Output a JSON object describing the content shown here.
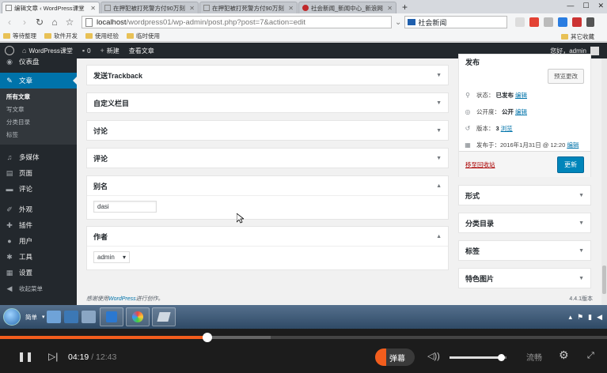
{
  "browser": {
    "tabs": [
      {
        "label": "编辑文章 ‹ WordPress课堂",
        "active": true
      },
      {
        "label": "在押犯被打死警方付90万刻",
        "active": false
      },
      {
        "label": "在押犯被打死警方付90万刻",
        "active": false
      },
      {
        "label": "社会新闻_新闻中心_新浪网",
        "active": false
      }
    ],
    "new_tab": "+",
    "window_controls": [
      "—",
      "☐",
      "✕"
    ],
    "url_host": "localhost",
    "url_path": "/wordpress01/wp-admin/post.php?post=7&action=edit",
    "search_value": "社会新闻",
    "bookmarks": [
      "等待整理",
      "软件开发",
      "使用经验",
      "临时使用"
    ],
    "bookmarks_right": "其它收藏"
  },
  "adminbar": {
    "site_name": "WordPress课堂",
    "comments_count": "0",
    "new_label": "新建",
    "view_post": "查看文章",
    "howdy": "您好，admin"
  },
  "sidebar": {
    "dashboard": "仪表盘",
    "posts": "文章",
    "sub_items": [
      "所有文章",
      "写文章",
      "分类目录",
      "标签"
    ],
    "media": "多媒体",
    "pages": "页面",
    "comments": "评论",
    "appearance": "外观",
    "plugins": "插件",
    "users": "用户",
    "tools": "工具",
    "settings": "设置",
    "collapse": "收起菜单"
  },
  "main": {
    "boxes": {
      "trackback": "发送Trackback",
      "custom_fields": "自定义栏目",
      "discussion": "讨论",
      "comments": "评论",
      "slug": "别名",
      "author": "作者"
    },
    "slug_value": "dasi",
    "author_value": "admin",
    "footer_prefix": "感谢使用",
    "footer_link": "WordPress",
    "footer_suffix": "进行创作。",
    "version": "4.4.1版本"
  },
  "publish": {
    "title": "发布",
    "preview_btn": "预览更改",
    "status_label": "状态：",
    "status_value": "已发布",
    "visibility_label": "公开度：",
    "visibility_value": "公开",
    "revisions_label": "版本：",
    "revisions_value": "3",
    "revisions_link": "浏览",
    "published_label": "发布于：",
    "published_value": "2016年1月31日 @ 12:20",
    "edit": "编辑",
    "trash": "移至回收站",
    "update_btn": "更新"
  },
  "right_boxes": {
    "format": "形式",
    "categories": "分类目录",
    "tags": "标签",
    "featured_image": "特色图片"
  },
  "taskbar": {
    "label": "简单"
  },
  "player": {
    "progress": 0.342,
    "buffered": 0.446,
    "current_time": "04:19",
    "total_time": "12:43",
    "danmu": "弹幕",
    "quality": "流畅",
    "volume": 0.9
  },
  "colors": {
    "wp_blue": "#0073aa",
    "admin_dark": "#23282d",
    "player_accent": "#f25d1d"
  }
}
